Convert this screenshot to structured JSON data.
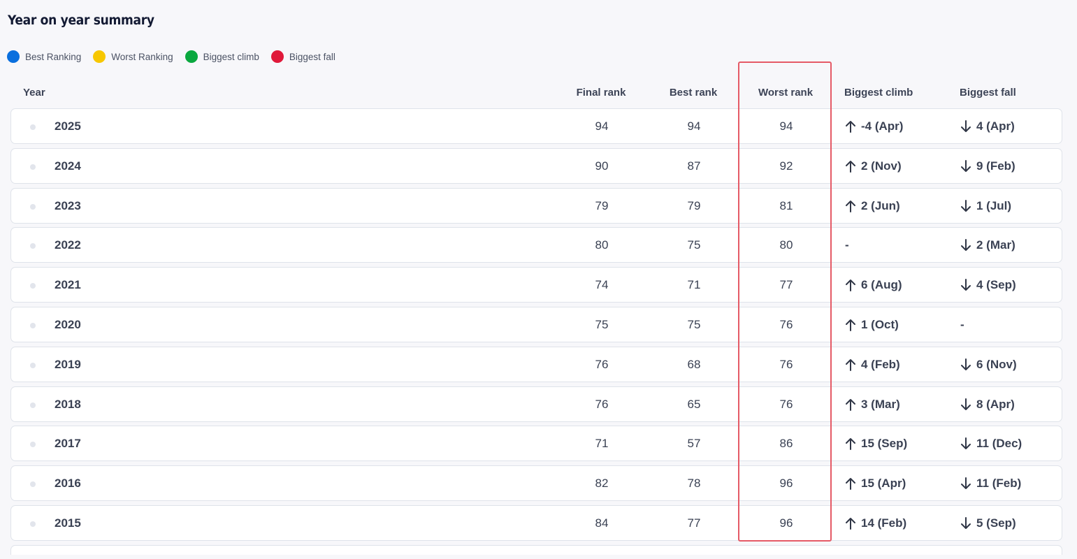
{
  "title": "Year on year summary",
  "legend": [
    {
      "label": "Best Ranking",
      "color": "#0a6fde"
    },
    {
      "label": "Worst Ranking",
      "color": "#f7c700"
    },
    {
      "label": "Biggest climb",
      "color": "#0aa83f"
    },
    {
      "label": "Biggest fall",
      "color": "#e0193a"
    }
  ],
  "columns": {
    "year": "Year",
    "final": "Final rank",
    "best": "Best rank",
    "worst": "Worst rank",
    "climb": "Biggest climb",
    "fall": "Biggest fall"
  },
  "rows": [
    {
      "year": "2025",
      "final": "94",
      "best": "94",
      "worst": "94",
      "climb": "-4 (Apr)",
      "fall": "4 (Apr)"
    },
    {
      "year": "2024",
      "final": "90",
      "best": "87",
      "worst": "92",
      "climb": "2 (Nov)",
      "fall": "9 (Feb)"
    },
    {
      "year": "2023",
      "final": "79",
      "best": "79",
      "worst": "81",
      "climb": "2 (Jun)",
      "fall": "1 (Jul)"
    },
    {
      "year": "2022",
      "final": "80",
      "best": "75",
      "worst": "80",
      "climb": "-",
      "fall": "2 (Mar)"
    },
    {
      "year": "2021",
      "final": "74",
      "best": "71",
      "worst": "77",
      "climb": "6 (Aug)",
      "fall": "4 (Sep)"
    },
    {
      "year": "2020",
      "final": "75",
      "best": "75",
      "worst": "76",
      "climb": "1 (Oct)",
      "fall": "-"
    },
    {
      "year": "2019",
      "final": "76",
      "best": "68",
      "worst": "76",
      "climb": "4 (Feb)",
      "fall": "6 (Nov)"
    },
    {
      "year": "2018",
      "final": "76",
      "best": "65",
      "worst": "76",
      "climb": "3 (Mar)",
      "fall": "8 (Apr)"
    },
    {
      "year": "2017",
      "final": "71",
      "best": "57",
      "worst": "86",
      "climb": "15 (Sep)",
      "fall": "11 (Dec)"
    },
    {
      "year": "2016",
      "final": "82",
      "best": "78",
      "worst": "96",
      "climb": "15 (Apr)",
      "fall": "11 (Feb)"
    },
    {
      "year": "2015",
      "final": "84",
      "best": "77",
      "worst": "96",
      "climb": "14 (Feb)",
      "fall": "5 (Sep)"
    }
  ],
  "highlight_color": "#e55a66"
}
